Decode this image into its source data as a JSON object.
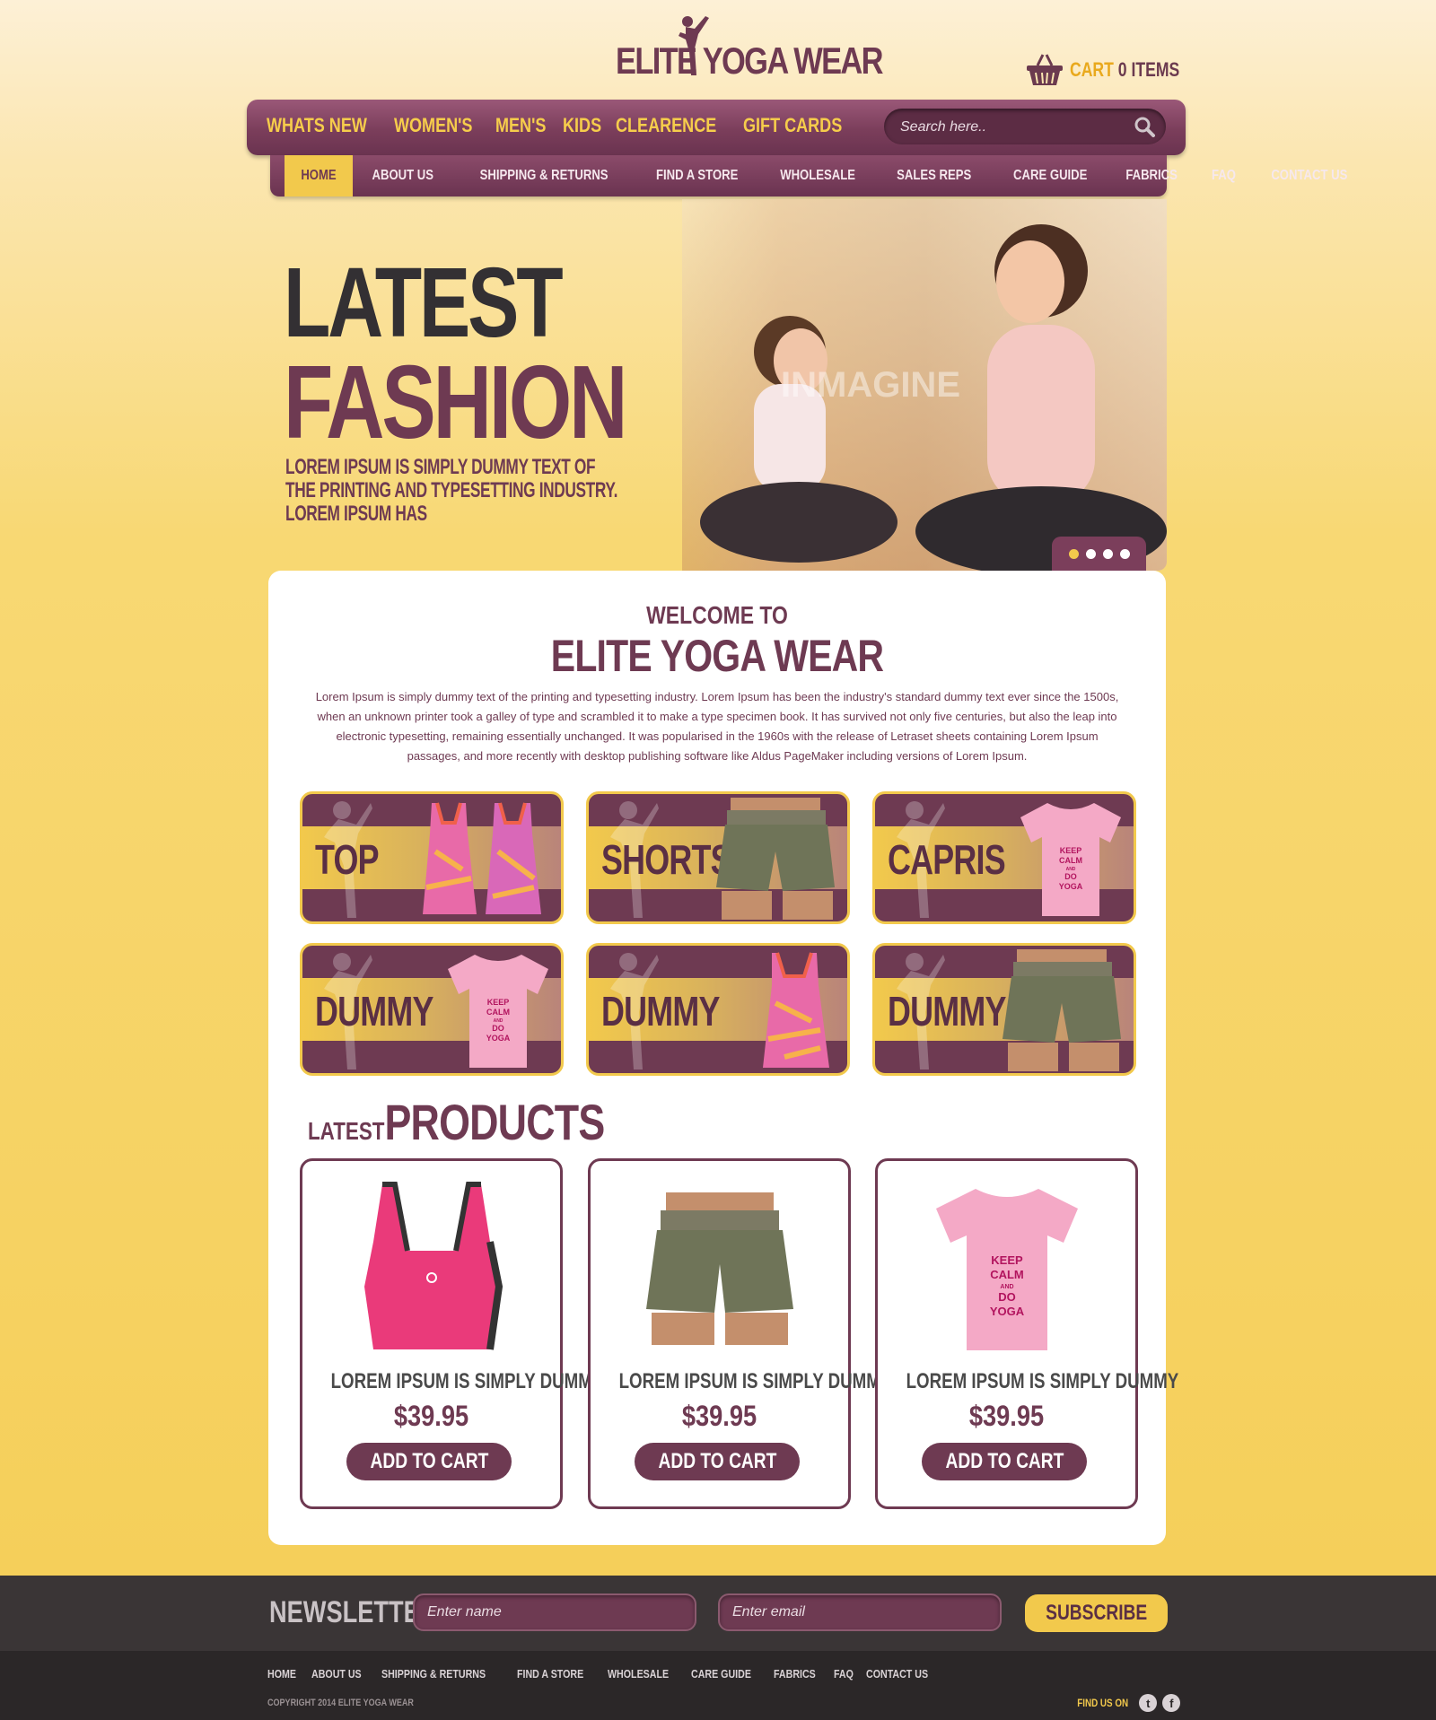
{
  "brand": {
    "logo_text": "ELITE YOGA WEAR"
  },
  "cart": {
    "label": "CART",
    "items": "0 ITEMS"
  },
  "main_nav": [
    "WHATS NEW",
    "WOMEN'S",
    "MEN'S",
    "KIDS",
    "CLEARENCE",
    "GIFT CARDS"
  ],
  "search": {
    "placeholder": "Search here.."
  },
  "sub_nav": {
    "items": [
      "HOME",
      "ABOUT US",
      "SHIPPING & RETURNS",
      "FIND A STORE",
      "WHOLESALE",
      "SALES REPS",
      "CARE GUIDE",
      "FABRICS",
      "FAQ",
      "CONTACT US"
    ],
    "active": "HOME"
  },
  "hero": {
    "line1": "LATEST",
    "line2": "FASHION",
    "text": "LOREM IPSUM IS SIMPLY DUMMY TEXT OF THE PRINTING AND TYPESETTING INDUSTRY. LOREM IPSUM HAS",
    "watermark": "INMAGINE",
    "slides": 4,
    "active_slide": 1
  },
  "welcome": {
    "small": "WELCOME TO",
    "big": "ELITE YOGA WEAR",
    "text": "Lorem Ipsum is simply dummy text of the printing and typesetting industry. Lorem Ipsum has been the industry's standard dummy text ever since the 1500s, when an unknown printer took a galley of type and scrambled it to make a type specimen book. It has survived not only five centuries, but also the leap into electronic typesetting, remaining essentially unchanged. It was popularised in the 1960s with the release of Letraset sheets containing Lorem Ipsum passages, and more recently with desktop publishing software like Aldus PageMaker including versions of Lorem Ipsum."
  },
  "categories": [
    {
      "label": "TOP",
      "image": "tank-top-icon"
    },
    {
      "label": "SHORTS",
      "image": "shorts-icon"
    },
    {
      "label": "CAPRIS",
      "image": "tshirt-icon"
    },
    {
      "label": "DUMMY",
      "image": "tshirt-icon"
    },
    {
      "label": "DUMMY",
      "image": "tank-top-icon"
    },
    {
      "label": "DUMMY",
      "image": "shorts-icon"
    }
  ],
  "tshirt_print": [
    "KEEP",
    "CALM",
    "AND",
    "DO",
    "YOGA"
  ],
  "latest": {
    "small": "LATEST",
    "big": "PRODUCTS"
  },
  "products": [
    {
      "name": "LOREM IPSUM IS SIMPLY DUMMY",
      "price": "$39.95",
      "button": "ADD TO CART",
      "image": "sports-bra-icon"
    },
    {
      "name": "LOREM IPSUM IS SIMPLY DUMMY",
      "price": "$39.95",
      "button": "ADD TO CART",
      "image": "shorts-icon"
    },
    {
      "name": "LOREM IPSUM IS SIMPLY DUMMY",
      "price": "$39.95",
      "button": "ADD TO CART",
      "image": "tshirt-icon"
    }
  ],
  "newsletter": {
    "title": "NEWSLETTER",
    "name_placeholder": "Enter name",
    "email_placeholder": "Enter email",
    "button": "SUBSCRIBE"
  },
  "footer": {
    "links": [
      "HOME",
      "ABOUT US",
      "SHIPPING & RETURNS",
      "FIND A STORE",
      "WHOLESALE",
      "CARE GUIDE",
      "FABRICS",
      "FAQ",
      "CONTACT US"
    ],
    "copyright": "COPYRIGHT 2014  ELITE YOGA WEAR",
    "find_us": "FIND US ON",
    "social": [
      "twitter-icon",
      "facebook-icon"
    ]
  },
  "colors": {
    "plum": "#6e3a52",
    "gold": "#f2c94c",
    "dark": "#3a3536"
  }
}
